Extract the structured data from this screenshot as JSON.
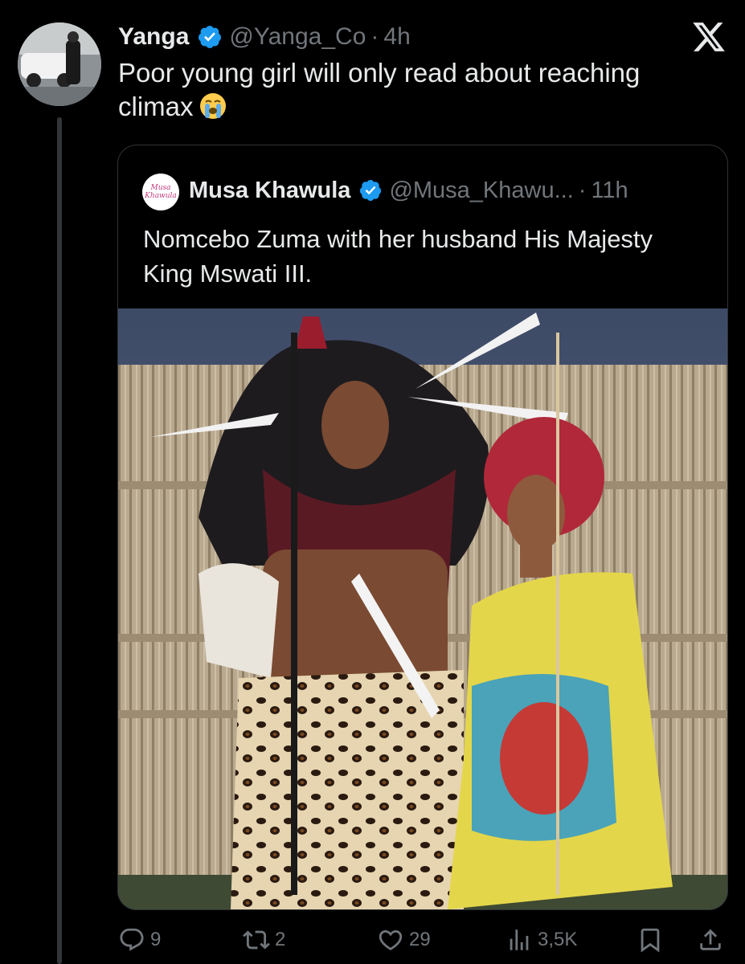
{
  "tweet": {
    "author_name": "Yanga",
    "handle": "@Yanga_Co",
    "separator": "·",
    "time": "4h",
    "text": "Poor young girl will only read about reaching climax",
    "emoji": "loudly-crying-face"
  },
  "quoted_tweet": {
    "avatar_text": "Musa Khawula",
    "author_name": "Musa Khawula",
    "handle": "@Musa_Khawu...",
    "separator": "·",
    "time": "11h",
    "text": "Nomcebo Zuma with her husband His Majesty King Mswati III.",
    "image": "photo-couple-traditional-attire"
  },
  "actions": {
    "replies": "9",
    "reposts": "2",
    "likes": "29",
    "views": "3,5K"
  },
  "colors": {
    "background": "#000000",
    "text": "#e7e9ea",
    "muted": "#71767b",
    "verified": "#1d9bf0",
    "border": "#2f3336"
  }
}
